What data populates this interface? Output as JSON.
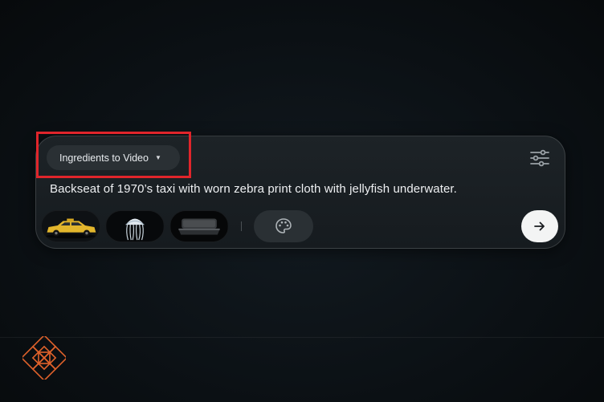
{
  "composer": {
    "mode_label": "Ingredients to Video",
    "prompt_text": "Backseat of 1970’s taxi with worn zebra print cloth with jellyfish underwater.",
    "ingredients": [
      {
        "name": "yellow-taxi-thumbnail"
      },
      {
        "name": "jellyfish-thumbnail"
      },
      {
        "name": "car-seat-thumbnail"
      }
    ],
    "icons": {
      "mode_caret": "caret-down-icon",
      "settings": "sliders-icon",
      "style": "palette-icon",
      "send": "arrow-right-icon",
      "brand": "geometric-flower-logo"
    }
  },
  "colors": {
    "highlight": "#e0252b",
    "logo": "#e0622b",
    "send_button": "#f3f4f4"
  }
}
